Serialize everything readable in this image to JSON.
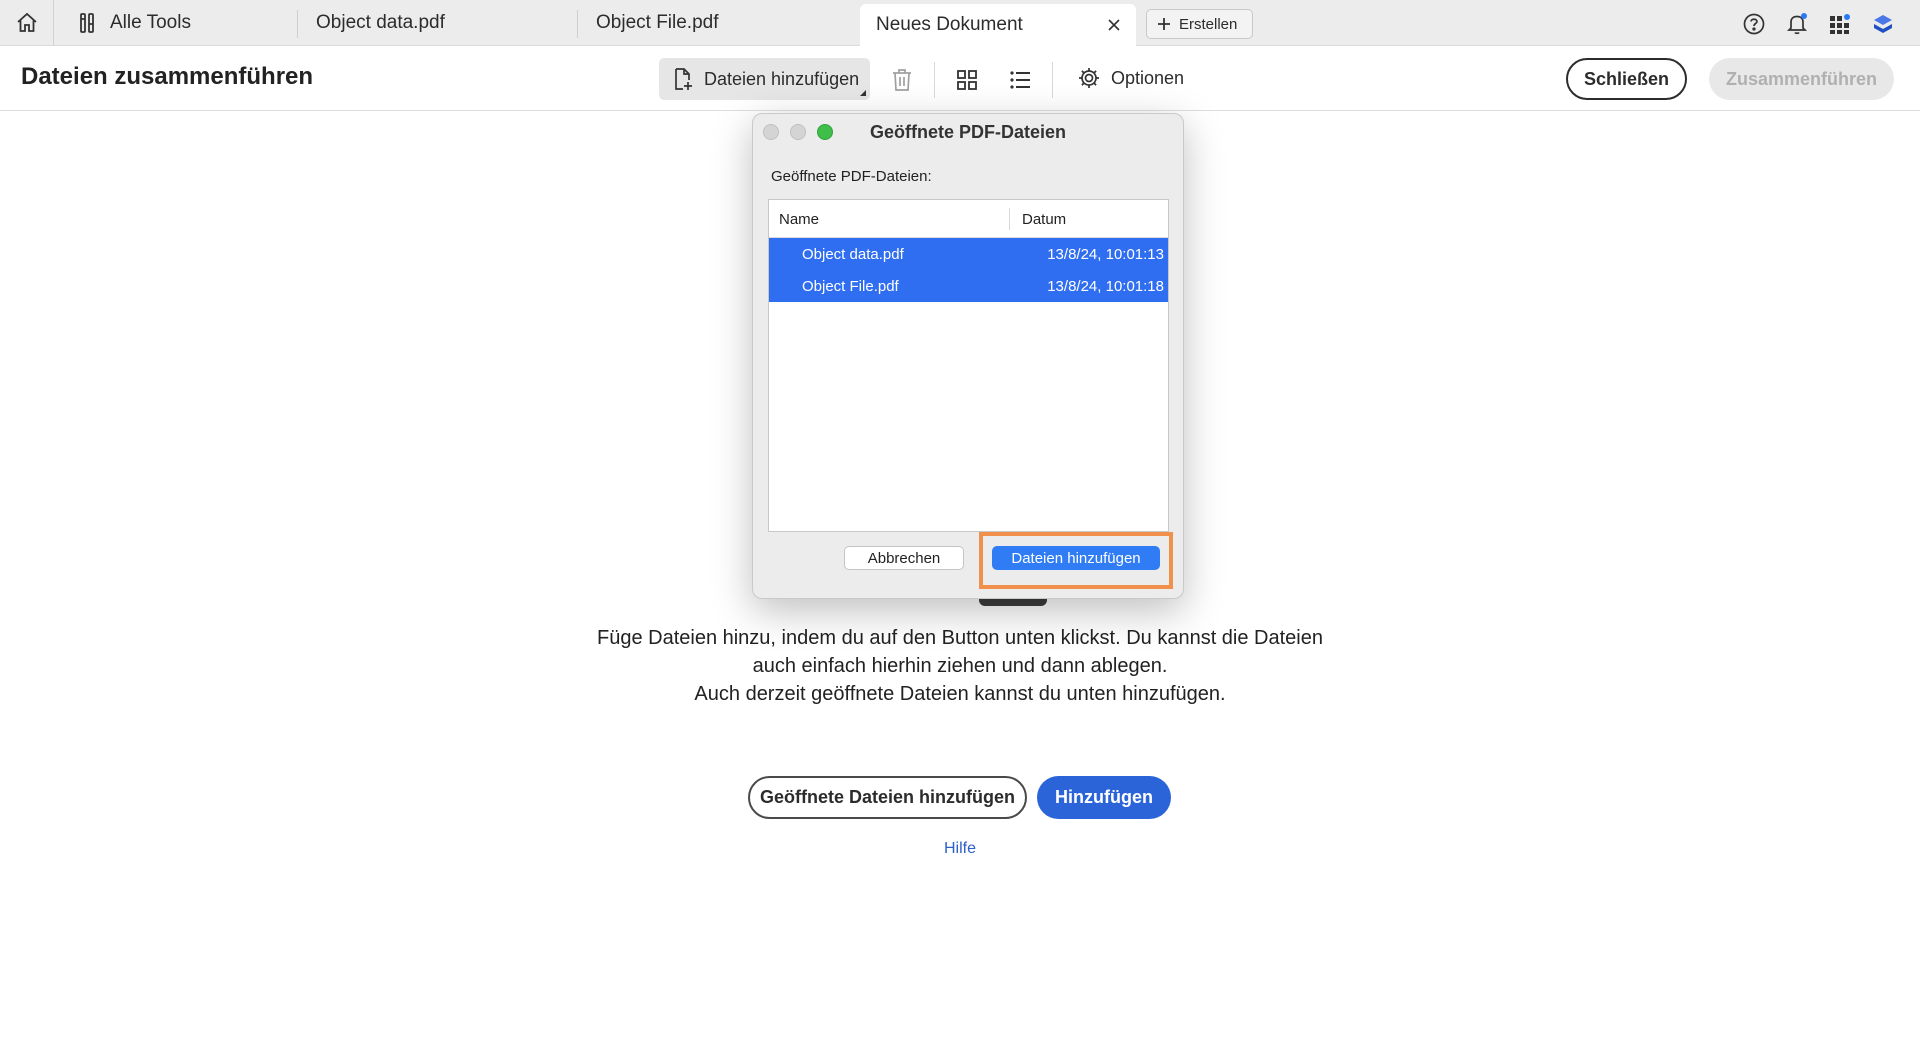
{
  "tabs": {
    "all_tools_label": "Alle Tools",
    "items": [
      {
        "label": "Object data.pdf"
      },
      {
        "label": "Object File.pdf"
      },
      {
        "label": "Neues Dokument"
      }
    ],
    "create_label": "Erstellen"
  },
  "toolbar": {
    "title": "Dateien zusammenführen",
    "add_files_label": "Dateien hinzufügen",
    "options_label": "Optionen",
    "close_label": "Schließen",
    "merge_label": "Zusammenführen"
  },
  "main": {
    "instruction_lines": [
      "Füge Dateien hinzu, indem du auf den Button unten klickst. Du kannst die Dateien",
      "auch einfach hierhin ziehen und dann ablegen.",
      "Auch derzeit geöffnete Dateien kannst du unten hinzufügen."
    ],
    "open_files_button": "Geöffnete Dateien hinzufügen",
    "add_button": "Hinzufügen",
    "help_link": "Hilfe"
  },
  "dialog": {
    "title": "Geöffnete PDF-Dateien",
    "label": "Geöffnete PDF-Dateien:",
    "columns": {
      "name": "Name",
      "date": "Datum"
    },
    "rows": [
      {
        "name": "Object data.pdf",
        "date": "13/8/24, 10:01:13"
      },
      {
        "name": "Object File.pdf",
        "date": "13/8/24, 10:01:18"
      }
    ],
    "cancel_label": "Abbrechen",
    "add_label": "Dateien hinzufügen"
  },
  "colors": {
    "accent": "#2b63d9",
    "selection": "#2f6ef0",
    "focus": "#f0904a"
  }
}
